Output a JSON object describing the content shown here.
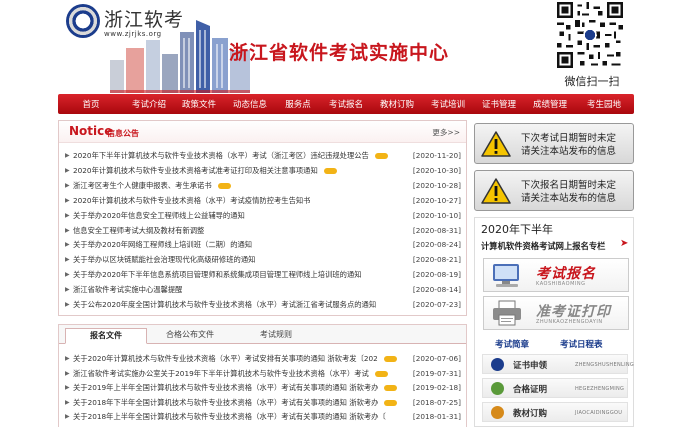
{
  "header": {
    "logo_text": "浙江软考",
    "logo_url": "www.zjrjks.org",
    "site_title": "浙江省软件考试实施中心",
    "qr_caption": "微信扫一扫"
  },
  "nav": {
    "items": [
      "首页",
      "考试介绍",
      "政策文件",
      "动态信息",
      "服务点",
      "考试报名",
      "教材订购",
      "考试培训",
      "证书管理",
      "成绩管理",
      "考生园地"
    ]
  },
  "notice": {
    "title": "Notice",
    "subtitle": "信息公告",
    "more": "更多>>",
    "rows": [
      {
        "text": "2020年下半年计算机技术与软件专业技术资格（水平）考试（浙江考区）违纪违规处理公告",
        "date": "[2020-11-20]",
        "new": true
      },
      {
        "text": "2020年计算机技术与软件专业技术资格考试准考证打印及相关注意事项通知",
        "date": "[2020-10-30]",
        "new": true
      },
      {
        "text": "浙江考区考生个人健康申报表、考生承诺书",
        "date": "[2020-10-28]",
        "new": true
      },
      {
        "text": "2020年计算机技术与软件专业技术资格（水平）考试疫情防控考生告知书",
        "date": "[2020-10-27]",
        "new": false
      },
      {
        "text": "关于举办2020年信息安全工程师线上公益辅导的通知",
        "date": "[2020-10-10]",
        "new": false
      },
      {
        "text": "信息安全工程师考试大纲及教材有新调整",
        "date": "[2020-08-31]",
        "new": false
      },
      {
        "text": "关于举办2020年网络工程师线上培训班（二期）的通知",
        "date": "[2020-08-24]",
        "new": false
      },
      {
        "text": "关于举办以区块链赋能社会治理现代化高级研修班的通知",
        "date": "[2020-08-21]",
        "new": false
      },
      {
        "text": "关于举办2020年下半年信息系统项目管理师和系统集成项目管理工程师线上培训班的通知",
        "date": "[2020-08-19]",
        "new": false
      },
      {
        "text": "浙江省软件考试实施中心温馨提醒",
        "date": "[2020-08-14]",
        "new": false
      },
      {
        "text": "关于公布2020年度全国计算机技术与软件专业技术资格（水平）考试浙江省考试服务点的通知",
        "date": "[2020-07-23]",
        "new": false
      }
    ]
  },
  "tabs": {
    "items": [
      "报名文件",
      "合格公布文件",
      "考试规则"
    ],
    "rows": [
      {
        "text": "关于2020年计算机技术与软件专业技术资格（水平）考试安排有关事项的通知 浙软考发〔202",
        "date": "[2020-07-06]",
        "new": true
      },
      {
        "text": "浙江省软件考试实施办公室关于2019年下半年计算机技术与软件专业技术资格（水平）考试",
        "date": "[2019-07-31]",
        "new": true
      },
      {
        "text": "关于2019年上半年全国计算机技术与软件专业技术资格（水平）考试有关事项的通知 浙软考办",
        "date": "[2019-02-18]",
        "new": true
      },
      {
        "text": "关于2018年下半年全国计算机技术与软件专业技术资格（水平）考试有关事项的通知 浙软考办",
        "date": "[2018-07-25]",
        "new": true
      },
      {
        "text": "关于2018年上半年全国计算机技术与软件专业技术资格（水平）考试有关事项的通知 浙软考办〔",
        "date": "[2018-01-31]",
        "new": false
      }
    ]
  },
  "alerts": [
    {
      "line1": "下次考试日期暂时未定",
      "line2": "请关注本站发布的信息"
    },
    {
      "line1": "下次报名日期暂时未定",
      "line2": "请关注本站发布的信息"
    }
  ],
  "signup": {
    "year": "2020年下半年",
    "heading": "计算机软件资格考试网上报名专栏",
    "register_label": "考试报名",
    "register_sub": "KAOSHIBAOMING",
    "print_label": "准考证打印",
    "print_sub": "ZHUNKAOZHENGDAYIN",
    "link_brief": "考试简章",
    "link_schedule": "考试日程表"
  },
  "side_items": [
    {
      "label": "证书申领",
      "sub": "ZHENGSHUSHENLING"
    },
    {
      "label": "合格证明",
      "sub": "HEGEZHENGMING"
    },
    {
      "label": "教材订购",
      "sub": "JIAOCAIDINGGOU"
    }
  ],
  "colors": {
    "brand_red": "#c8161d",
    "nav_red": "#b8101a",
    "link_blue": "#1b3c8c",
    "new_badge": "#f2b316"
  }
}
